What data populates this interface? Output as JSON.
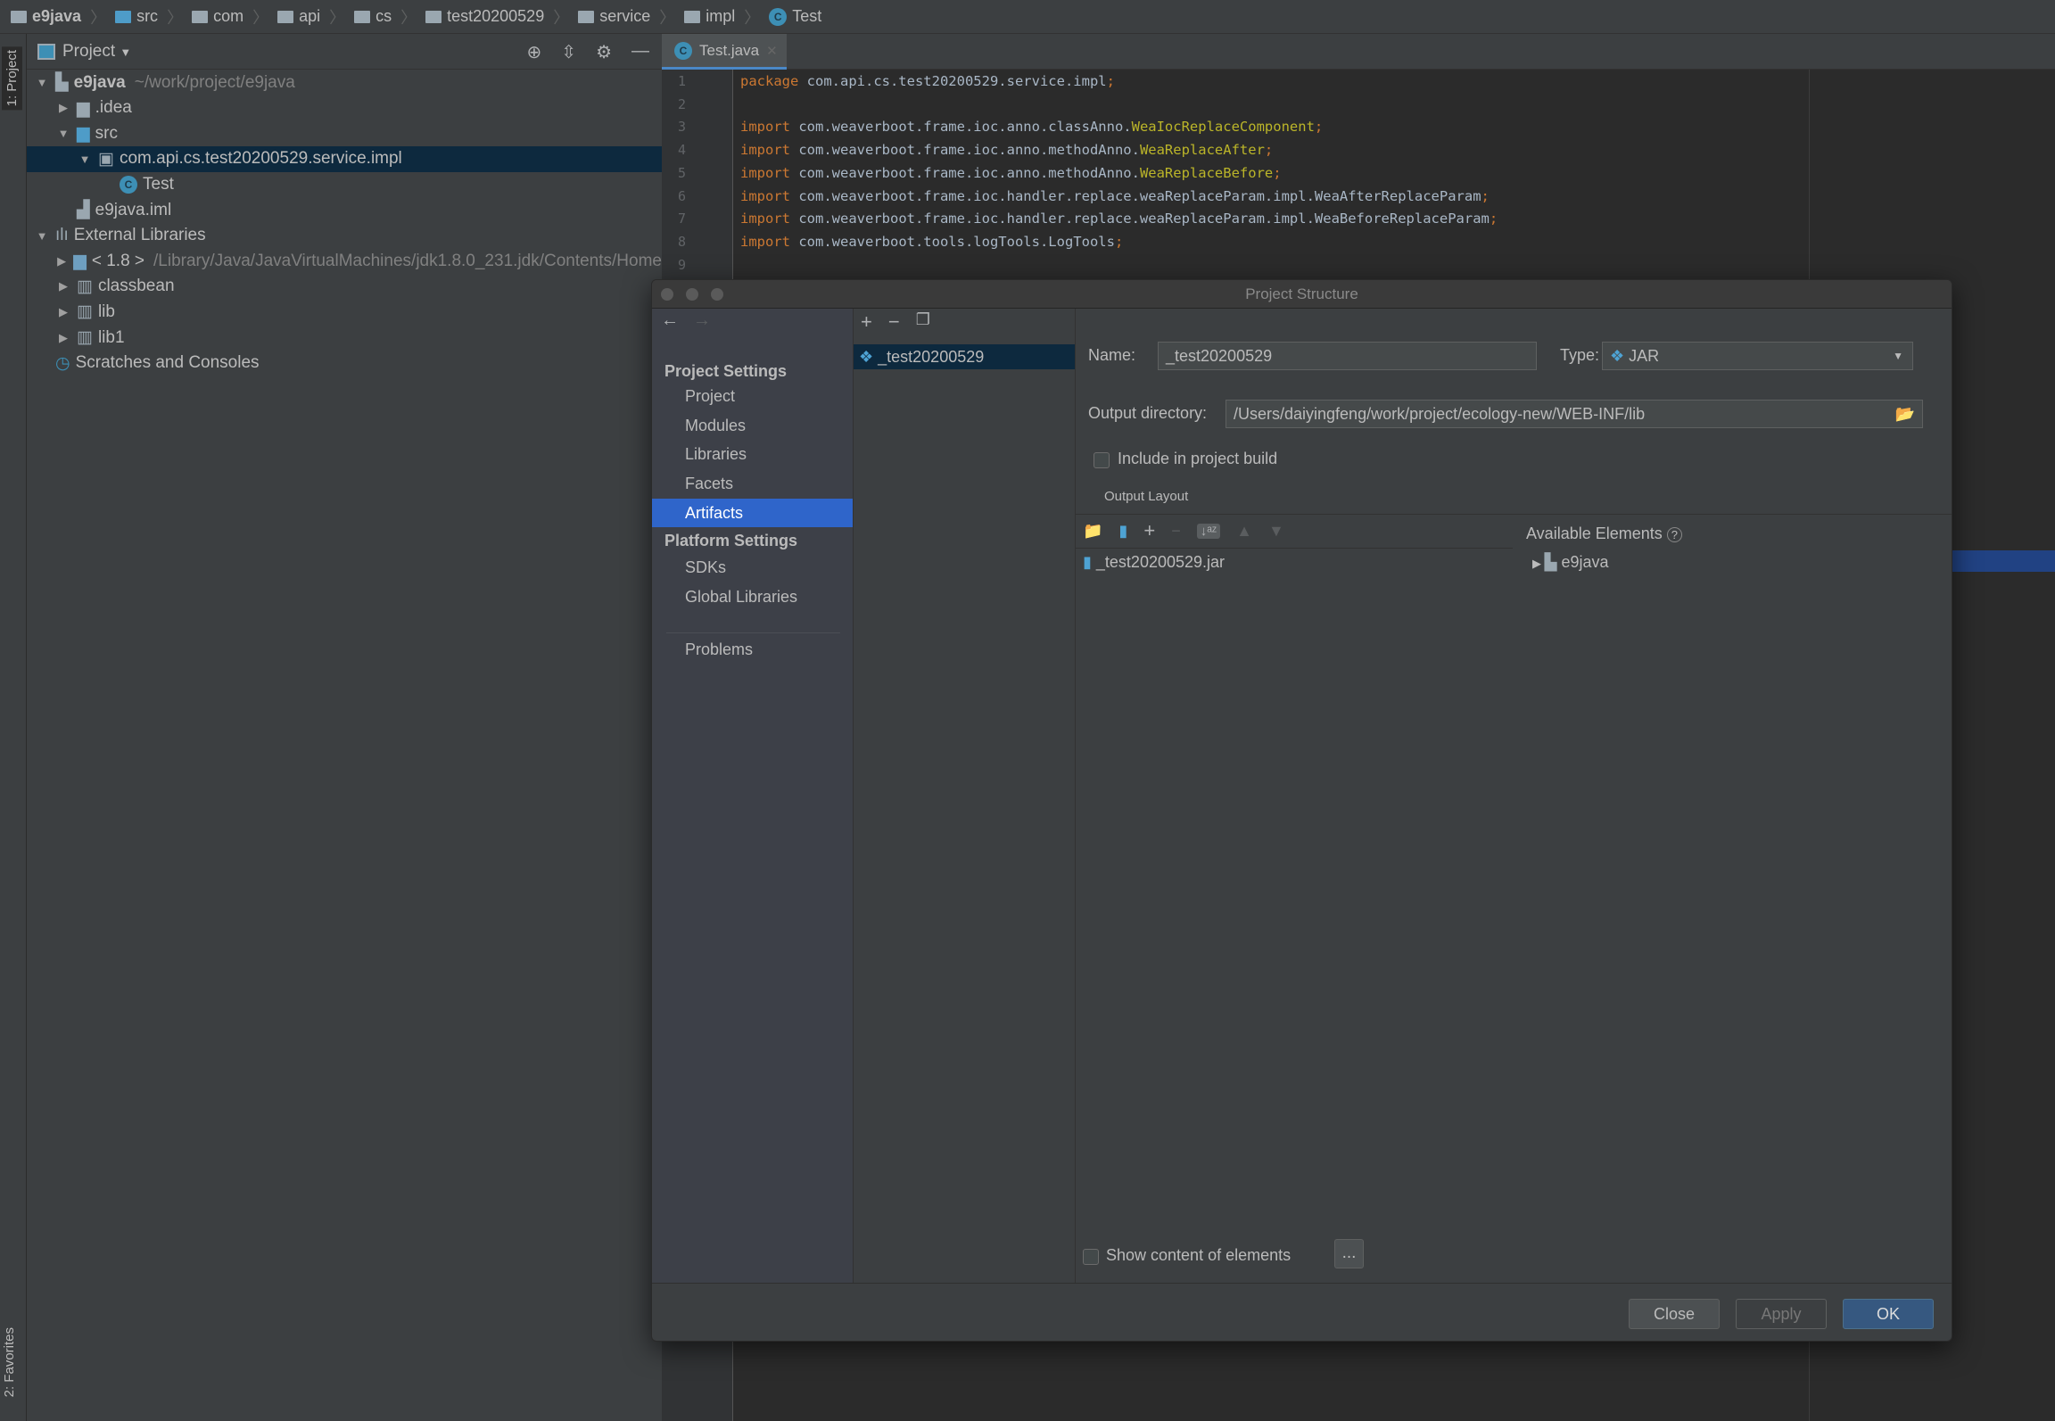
{
  "breadcrumb": [
    "e9java",
    "src",
    "com",
    "api",
    "cs",
    "test20200529",
    "service",
    "impl",
    "Test"
  ],
  "left_strip": {
    "project": "1: Project",
    "favorites": "2: Favorites"
  },
  "project_panel": {
    "title": "Project",
    "tree": [
      {
        "label": "e9java",
        "hint": "~/work/project/e9java",
        "depth": 0,
        "expanded": true,
        "icon": "module-folder-icon",
        "bold": true
      },
      {
        "label": ".idea",
        "depth": 1,
        "expanded": false,
        "icon": "folder-icon"
      },
      {
        "label": "src",
        "depth": 1,
        "expanded": true,
        "icon": "source-folder-icon"
      },
      {
        "label": "com.api.cs.test20200529.service.impl",
        "depth": 2,
        "expanded": true,
        "icon": "package-icon",
        "selected": true
      },
      {
        "label": "Test",
        "depth": 3,
        "icon": "java-class-icon"
      },
      {
        "label": "e9java.iml",
        "depth": 1,
        "icon": "iml-file-icon"
      },
      {
        "label": "External Libraries",
        "depth": 0,
        "expanded": true,
        "icon": "libraries-icon"
      },
      {
        "label": "< 1.8 >",
        "hint": "/Library/Java/JavaVirtualMachines/jdk1.8.0_231.jdk/Contents/Home",
        "depth": 1,
        "expanded": false,
        "icon": "jdk-icon"
      },
      {
        "label": "classbean",
        "depth": 1,
        "expanded": false,
        "icon": "library-icon"
      },
      {
        "label": "lib",
        "depth": 1,
        "expanded": false,
        "icon": "library-icon"
      },
      {
        "label": "lib1",
        "depth": 1,
        "expanded": false,
        "icon": "library-icon"
      },
      {
        "label": "Scratches and Consoles",
        "depth": 0,
        "icon": "scratches-icon"
      }
    ]
  },
  "editor": {
    "tab": "Test.java",
    "lines": [
      {
        "n": "1",
        "kw": "package",
        "text": " com.api.cs.test20200529.service.impl",
        "hl": "",
        "end": ";"
      },
      {
        "n": "2",
        "kw": "",
        "text": "",
        "hl": "",
        "end": ""
      },
      {
        "n": "3",
        "kw": "import",
        "text": " com.weaverboot.frame.ioc.anno.classAnno.",
        "hl": "WeaIocReplaceComponent",
        "end": ";"
      },
      {
        "n": "4",
        "kw": "import",
        "text": " com.weaverboot.frame.ioc.anno.methodAnno.",
        "hl": "WeaReplaceAfter",
        "end": ";"
      },
      {
        "n": "5",
        "kw": "import",
        "text": " com.weaverboot.frame.ioc.anno.methodAnno.",
        "hl": "WeaReplaceBefore",
        "end": ";"
      },
      {
        "n": "6",
        "kw": "import",
        "text": " com.weaverboot.frame.ioc.handler.replace.weaReplaceParam.impl.WeaAfterReplaceParam",
        "hl": "",
        "end": ";"
      },
      {
        "n": "7",
        "kw": "import",
        "text": " com.weaverboot.frame.ioc.handler.replace.weaReplaceParam.impl.WeaBeforeReplaceParam",
        "hl": "",
        "end": ";"
      },
      {
        "n": "8",
        "kw": "import",
        "text": " com.weaverboot.tools.logTools.LogTools",
        "hl": "",
        "end": ";"
      },
      {
        "n": "9",
        "kw": "",
        "text": "",
        "hl": "",
        "end": ""
      }
    ]
  },
  "dialog": {
    "title": "Project Structure",
    "nav": {
      "project_settings": "Project Settings",
      "project_items": [
        "Project",
        "Modules",
        "Libraries",
        "Facets",
        "Artifacts"
      ],
      "active": "Artifacts",
      "platform_settings": "Platform Settings",
      "platform_items": [
        "SDKs",
        "Global Libraries"
      ],
      "problems": "Problems"
    },
    "artifacts": [
      "_test20200529"
    ],
    "name_label": "Name:",
    "name_value": "_test20200529",
    "type_label": "Type:",
    "type_value": "JAR",
    "output_dir_label": "Output directory:",
    "output_dir_value": "/Users/daiyingfeng/work/project/ecology-new/WEB-INF/lib",
    "include_build": "Include in project build",
    "include_build_checked": false,
    "output_layout": "Output Layout",
    "layout_items": [
      "_test20200529.jar"
    ],
    "available_elements": "Available Elements",
    "available_items": [
      "e9java"
    ],
    "show_content": "Show content of elements",
    "show_content_checked": false,
    "more_button": "...",
    "buttons": {
      "close": "Close",
      "apply": "Apply",
      "ok": "OK"
    },
    "colors": {
      "accent": "#2f65ca",
      "ok": "#365880"
    }
  }
}
